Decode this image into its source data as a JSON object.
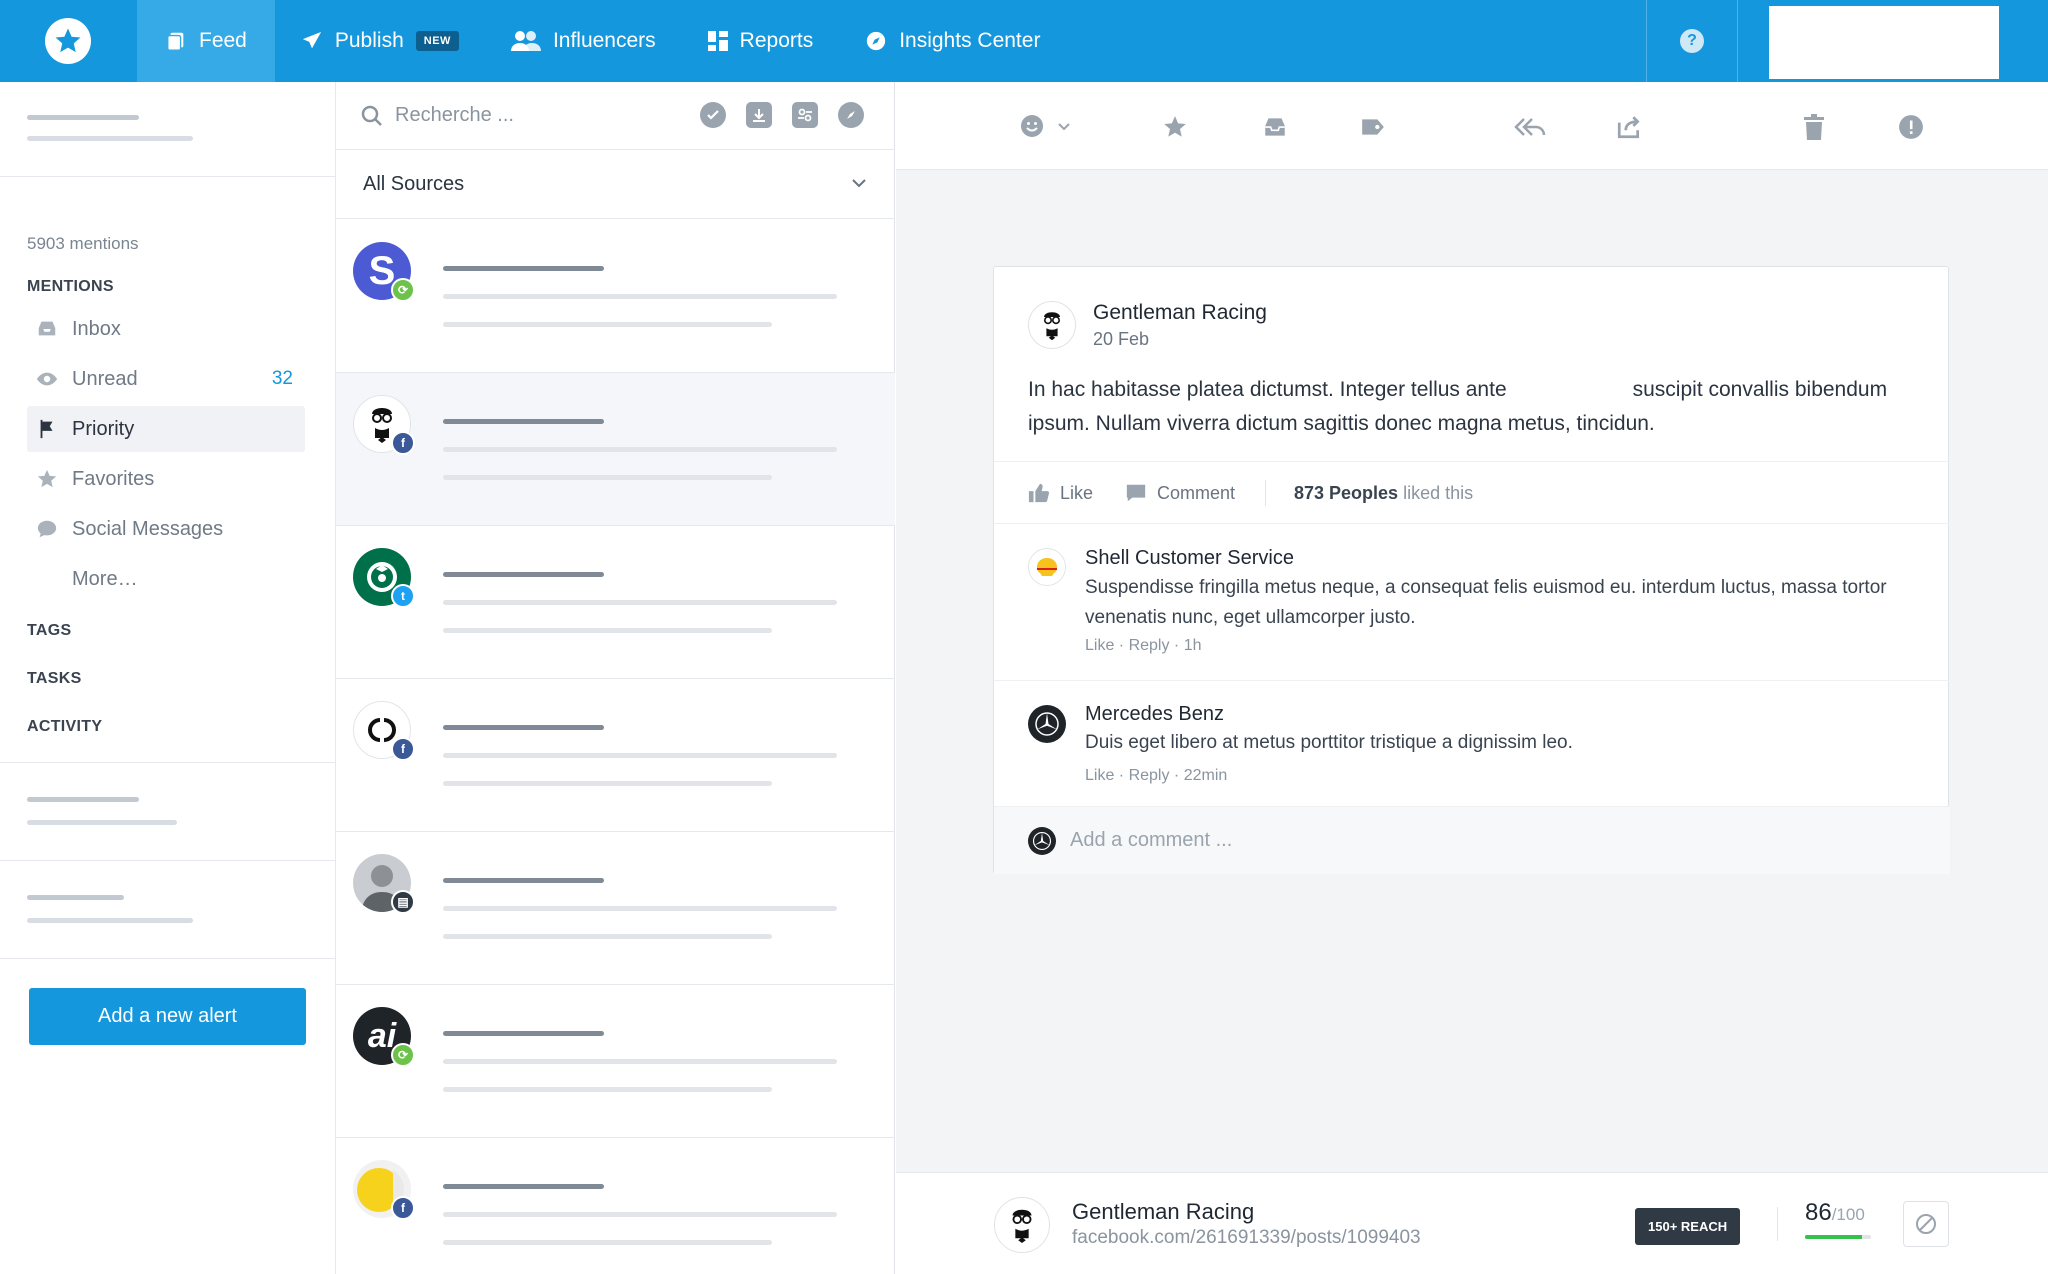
{
  "nav": {
    "items": [
      {
        "label": "Feed",
        "icon": "feed-icon",
        "active": true
      },
      {
        "label": "Publish",
        "icon": "paper-plane-icon",
        "badge": "NEW"
      },
      {
        "label": "Influencers",
        "icon": "users-icon"
      },
      {
        "label": "Reports",
        "icon": "dashboard-icon"
      },
      {
        "label": "Insights Center",
        "icon": "compass-icon"
      }
    ],
    "help": "?"
  },
  "sidebar": {
    "mentions_count": "5903 mentions",
    "mentions_label": "MENTIONS",
    "items": [
      {
        "label": "Inbox",
        "icon": "inbox-icon"
      },
      {
        "label": "Unread",
        "icon": "eye-icon",
        "count": "32"
      },
      {
        "label": "Priority",
        "icon": "flag-icon",
        "selected": true
      },
      {
        "label": "Favorites",
        "icon": "star-icon"
      },
      {
        "label": "Social Messages",
        "icon": "chat-bubble-icon"
      }
    ],
    "more": "More…",
    "tags": "TAGS",
    "tasks": "TASKS",
    "activity": "ACTIVITY",
    "add_alert": "Add a new alert"
  },
  "feed": {
    "search_placeholder": "Recherche ...",
    "sources_label": "All Sources",
    "items": [
      {
        "avatar": "s-logo",
        "network": "rss",
        "network_color": "#6cc24a"
      },
      {
        "avatar": "gentleman-racing-logo",
        "network": "facebook",
        "network_color": "#3b5998",
        "selected": true
      },
      {
        "avatar": "starbucks-logo",
        "network": "twitter",
        "network_color": "#1da1f2"
      },
      {
        "avatar": "chanel-logo",
        "network": "facebook",
        "network_color": "#3b5998"
      },
      {
        "avatar": "person-photo",
        "network": "news",
        "network_color": "#2f3a45"
      },
      {
        "avatar": "ai-logo",
        "network": "rss",
        "network_color": "#6cc24a"
      },
      {
        "avatar": "yellow-logo",
        "network": "facebook",
        "network_color": "#3b5998"
      }
    ]
  },
  "post": {
    "author": "Gentleman Racing",
    "date": "20 Feb",
    "text_part1": "In hac habitasse platea dictumst. Integer tellus ante",
    "text_part2": "suscipit convallis bibendum ipsum. Nullam viverra dictum sagittis donec magna metus, tincidun.",
    "like_label": "Like",
    "comment_label": "Comment",
    "likes_count": "873 Peoples",
    "likes_suffix": "liked this",
    "comments": [
      {
        "name": "Shell Customer Service",
        "text": "Suspendisse fringilla metus neque, a consequat felis euismod eu. interdum luctus, massa tortor venenatis nunc, eget ullamcorper justo.",
        "like": "Like",
        "reply": "Reply",
        "time": "1h"
      },
      {
        "name": "Mercedes Benz",
        "text": "Duis eget libero at metus porttitor tristique a dignissim leo.",
        "like": "Like",
        "reply": "Reply",
        "time": "22min"
      }
    ],
    "add_comment_placeholder": "Add a comment ..."
  },
  "footer": {
    "name": "Gentleman Racing",
    "url": "facebook.com/261691339/posts/1099403",
    "reach": "150+ REACH",
    "score": "86",
    "score_max": "/100",
    "score_fraction": 0.86
  },
  "colors": {
    "primary": "#1497dc",
    "nav_active": "#36aae6",
    "dark": "#2f3a45",
    "score_green": "#35c24b"
  }
}
